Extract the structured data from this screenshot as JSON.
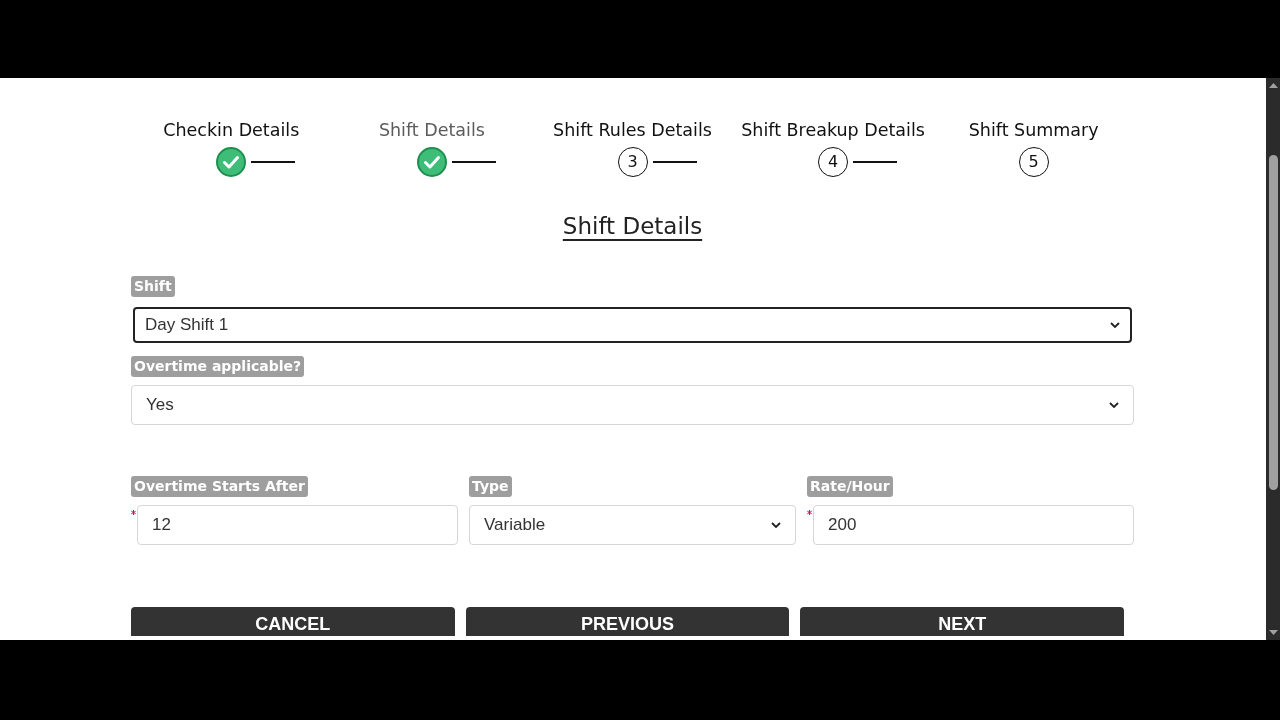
{
  "steps": [
    {
      "label": "Checkin Details",
      "done": true,
      "selected": false
    },
    {
      "label": "Shift Details",
      "done": true,
      "selected": true
    },
    {
      "label": "Shift Rules Details",
      "done": false,
      "number": "3",
      "selected": false
    },
    {
      "label": "Shift Breakup Details",
      "done": false,
      "number": "4",
      "selected": false
    },
    {
      "label": "Shift Summary",
      "done": false,
      "number": "5",
      "selected": false
    }
  ],
  "heading": "Shift Details",
  "fields": [
    {
      "kind": "select",
      "label": "Shift",
      "value": "Day Shift 1",
      "focused": true
    },
    {
      "kind": "select",
      "label": "Overtime applicable?",
      "value": "Yes",
      "focused": false
    }
  ],
  "overtime_fields": [
    {
      "kind": "input",
      "label": "Overtime Starts After",
      "value": "12",
      "required": true
    },
    {
      "kind": "select",
      "label": "Type",
      "value": "Variable",
      "required": false
    },
    {
      "kind": "input",
      "label": "Rate/Hour",
      "value": "200",
      "required": true
    }
  ],
  "buttons": [
    "CANCEL",
    "PREVIOUS",
    "NEXT"
  ]
}
